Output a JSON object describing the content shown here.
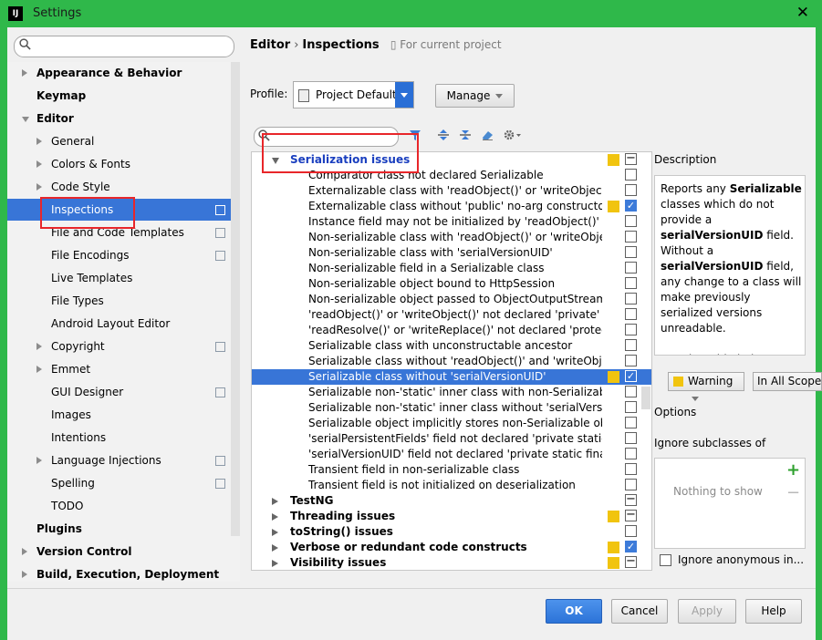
{
  "window": {
    "title": "Settings",
    "app_icon": "IJ"
  },
  "sidebar": {
    "items": [
      {
        "label": "Appearance & Behavior",
        "bold": true,
        "arrow": "right",
        "indent": 0
      },
      {
        "label": "Keymap",
        "bold": true,
        "arrow": "none",
        "indent": 0
      },
      {
        "label": "Editor",
        "bold": true,
        "arrow": "down",
        "indent": 0
      },
      {
        "label": "General",
        "bold": false,
        "arrow": "right",
        "indent": 1
      },
      {
        "label": "Colors & Fonts",
        "bold": false,
        "arrow": "right",
        "indent": 1
      },
      {
        "label": "Code Style",
        "bold": false,
        "arrow": "right",
        "indent": 1
      },
      {
        "label": "Inspections",
        "bold": false,
        "arrow": "none",
        "indent": 1,
        "selected": true,
        "copy": true
      },
      {
        "label": "File and Code Templates",
        "bold": false,
        "arrow": "none",
        "indent": 1,
        "copy": true
      },
      {
        "label": "File Encodings",
        "bold": false,
        "arrow": "none",
        "indent": 1,
        "copy": true
      },
      {
        "label": "Live Templates",
        "bold": false,
        "arrow": "none",
        "indent": 1
      },
      {
        "label": "File Types",
        "bold": false,
        "arrow": "none",
        "indent": 1
      },
      {
        "label": "Android Layout Editor",
        "bold": false,
        "arrow": "none",
        "indent": 1
      },
      {
        "label": "Copyright",
        "bold": false,
        "arrow": "right",
        "indent": 1,
        "copy": true
      },
      {
        "label": "Emmet",
        "bold": false,
        "arrow": "right",
        "indent": 1
      },
      {
        "label": "GUI Designer",
        "bold": false,
        "arrow": "none",
        "indent": 1,
        "copy": true
      },
      {
        "label": "Images",
        "bold": false,
        "arrow": "none",
        "indent": 1
      },
      {
        "label": "Intentions",
        "bold": false,
        "arrow": "none",
        "indent": 1
      },
      {
        "label": "Language Injections",
        "bold": false,
        "arrow": "right",
        "indent": 1,
        "copy": true
      },
      {
        "label": "Spelling",
        "bold": false,
        "arrow": "none",
        "indent": 1,
        "copy": true
      },
      {
        "label": "TODO",
        "bold": false,
        "arrow": "none",
        "indent": 1
      },
      {
        "label": "Plugins",
        "bold": true,
        "arrow": "none",
        "indent": 0
      },
      {
        "label": "Version Control",
        "bold": true,
        "arrow": "right",
        "indent": 0
      },
      {
        "label": "Build, Execution, Deployment",
        "bold": true,
        "arrow": "right",
        "indent": 0
      }
    ]
  },
  "header": {
    "crumb1": "Editor",
    "sep": "›",
    "crumb2": "Inspections",
    "project_note": "For current project"
  },
  "profile": {
    "label": "Profile:",
    "value": "Project Default",
    "manage_label": "Manage"
  },
  "tree": {
    "rows": [
      {
        "label": "Serialization issues",
        "type": "header",
        "arrow": "down",
        "sev": true,
        "check": "partial"
      },
      {
        "label": "Comparator class not declared Serializable",
        "type": "item",
        "sev": false,
        "check": "off"
      },
      {
        "label": "Externalizable class with 'readObject()' or 'writeObject()'",
        "type": "item",
        "sev": false,
        "check": "off"
      },
      {
        "label": "Externalizable class without 'public' no-arg constructor",
        "type": "item",
        "sev": true,
        "check": "on"
      },
      {
        "label": "Instance field may not be initialized by 'readObject()'",
        "type": "item",
        "sev": false,
        "check": "off"
      },
      {
        "label": "Non-serializable class with 'readObject()' or 'writeObject()'",
        "type": "item",
        "sev": false,
        "check": "off"
      },
      {
        "label": "Non-serializable class with 'serialVersionUID'",
        "type": "item",
        "sev": false,
        "check": "off"
      },
      {
        "label": "Non-serializable field in a Serializable class",
        "type": "item",
        "sev": false,
        "check": "off"
      },
      {
        "label": "Non-serializable object bound to HttpSession",
        "type": "item",
        "sev": false,
        "check": "off"
      },
      {
        "label": "Non-serializable object passed to ObjectOutputStream",
        "type": "item",
        "sev": false,
        "check": "off"
      },
      {
        "label": "'readObject()' or 'writeObject()' not declared 'private'",
        "type": "item",
        "sev": false,
        "check": "off"
      },
      {
        "label": "'readResolve()' or 'writeReplace()' not declared 'protected'",
        "type": "item",
        "sev": false,
        "check": "off"
      },
      {
        "label": "Serializable class with unconstructable ancestor",
        "type": "item",
        "sev": false,
        "check": "off"
      },
      {
        "label": "Serializable class without 'readObject()' and 'writeObject()'",
        "type": "item",
        "sev": false,
        "check": "off"
      },
      {
        "label": "Serializable class without 'serialVersionUID'",
        "type": "item",
        "sev": true,
        "check": "on",
        "selected": true
      },
      {
        "label": "Serializable non-'static' inner class with non-Serializable outer class",
        "type": "item",
        "sev": false,
        "check": "off"
      },
      {
        "label": "Serializable non-'static' inner class without 'serialVersionUID'",
        "type": "item",
        "sev": false,
        "check": "off"
      },
      {
        "label": "Serializable object implicitly stores non-Serializable object",
        "type": "item",
        "sev": false,
        "check": "off"
      },
      {
        "label": "'serialPersistentFields' field not declared 'private static final'",
        "type": "item",
        "sev": false,
        "check": "off"
      },
      {
        "label": "'serialVersionUID' field not declared 'private static final long'",
        "type": "item",
        "sev": false,
        "check": "off"
      },
      {
        "label": "Transient field in non-serializable class",
        "type": "item",
        "sev": false,
        "check": "off"
      },
      {
        "label": "Transient field is not initialized on deserialization",
        "type": "item",
        "sev": false,
        "check": "off"
      },
      {
        "label": "TestNG",
        "type": "group",
        "arrow": "right",
        "sev": false,
        "check": "partial"
      },
      {
        "label": "Threading issues",
        "type": "group",
        "arrow": "right",
        "sev": true,
        "check": "partial"
      },
      {
        "label": "toString() issues",
        "type": "group",
        "arrow": "right",
        "sev": false,
        "check": "off"
      },
      {
        "label": "Verbose or redundant code constructs",
        "type": "group",
        "arrow": "right",
        "sev": true,
        "check": "on"
      },
      {
        "label": "Visibility issues",
        "type": "group",
        "arrow": "right",
        "sev": true,
        "check": "partial"
      }
    ]
  },
  "description": {
    "title": "Description",
    "text_html": "Reports any <b>Serializable</b> classes which do not provide a <b>serialVersionUID</b> field. Without a <b>serialVersionUID</b> field, any change to a class will make previously serialized versions unreadable.<br><br>Use the table below to specify what specific classes and inheritors"
  },
  "severity": {
    "value": "Warning",
    "scope": "In All Scopes"
  },
  "options": {
    "title": "Options",
    "ignore_subclasses": "Ignore subclasses of",
    "empty_list": "Nothing to show",
    "add": "+",
    "remove": "−",
    "ignore_anonymous": "Ignore anonymous in..."
  },
  "buttons": {
    "ok": "OK",
    "cancel": "Cancel",
    "apply": "Apply",
    "help": "Help"
  },
  "colors": {
    "accent": "#3875d7",
    "frame": "#2fb84a",
    "severity_warning": "#f1c40f",
    "highlight": "#e8262a"
  }
}
